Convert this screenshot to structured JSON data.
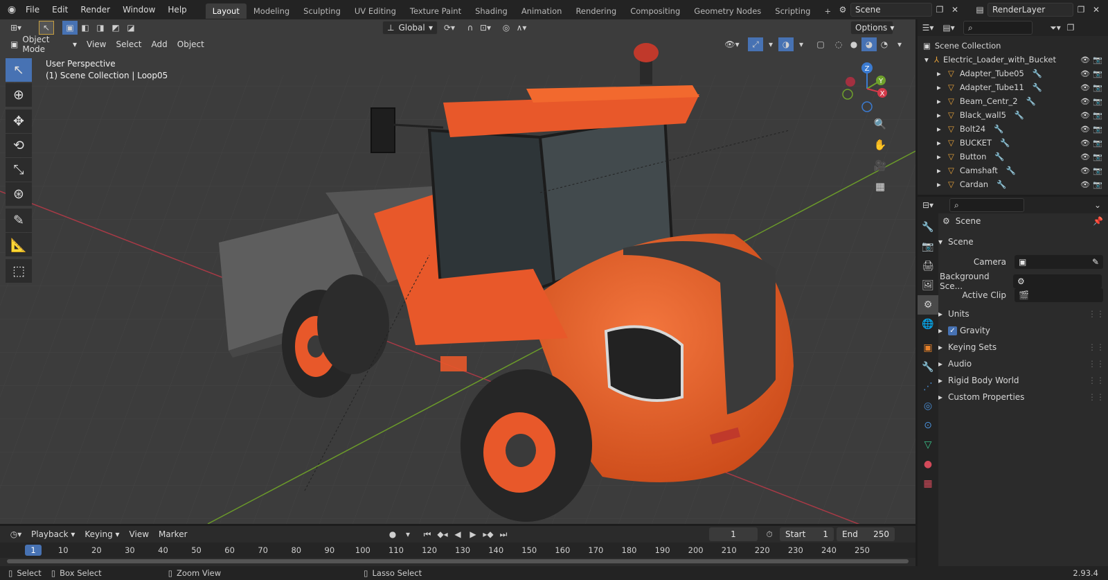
{
  "app": {
    "version": "2.93.4"
  },
  "menus": [
    "File",
    "Edit",
    "Render",
    "Window",
    "Help"
  ],
  "workspaces": [
    "Layout",
    "Modeling",
    "Sculpting",
    "UV Editing",
    "Texture Paint",
    "Shading",
    "Animation",
    "Rendering",
    "Compositing",
    "Geometry Nodes",
    "Scripting"
  ],
  "active_workspace": "Layout",
  "scene": {
    "name": "Scene",
    "view_layer": "RenderLayer"
  },
  "viewport": {
    "transform_orientation": "Global",
    "options_label": "Options",
    "mode": "Object Mode",
    "menus": [
      "View",
      "Select",
      "Add",
      "Object"
    ],
    "overlay_title": "User Perspective",
    "overlay_subtitle": "(1) Scene Collection | Loop05",
    "gizmo_axes": {
      "x": "X",
      "y": "Y",
      "z": "Z"
    }
  },
  "outliner": {
    "root": "Scene Collection",
    "object": "Electric_Loader_with_Bucket",
    "items": [
      "Adapter_Tube05",
      "Adapter_Tube11",
      "Beam_Centr_2",
      "Black_wall5",
      "Bolt24",
      "BUCKET",
      "Button",
      "Camshaft",
      "Cardan"
    ]
  },
  "properties": {
    "header": "Scene",
    "panel": "Scene",
    "camera_label": "Camera",
    "background_label": "Background Sce...",
    "active_clip_label": "Active Clip",
    "gravity_label": "Gravity",
    "gravity_checked": true,
    "sections": [
      "Units",
      "Keying Sets",
      "Audio",
      "Rigid Body World",
      "Custom Properties"
    ]
  },
  "timeline": {
    "menus": [
      "Playback",
      "Keying",
      "View",
      "Marker"
    ],
    "current_frame": "1",
    "start_label": "Start",
    "start": "1",
    "end_label": "End",
    "end": "250",
    "ticks": [
      "1",
      "10",
      "20",
      "30",
      "40",
      "50",
      "60",
      "70",
      "80",
      "90",
      "100",
      "110",
      "120",
      "130",
      "140",
      "150",
      "160",
      "170",
      "180",
      "190",
      "200",
      "210",
      "220",
      "230",
      "240",
      "250"
    ]
  },
  "statusbar": {
    "select": "Select",
    "box_select": "Box Select",
    "zoom_view": "Zoom View",
    "lasso_select": "Lasso Select"
  },
  "colors": {
    "accent": "#4772b3",
    "machine_orange": "#e8582a",
    "x_axis": "#a83a46",
    "y_axis": "#6b9a2a"
  }
}
